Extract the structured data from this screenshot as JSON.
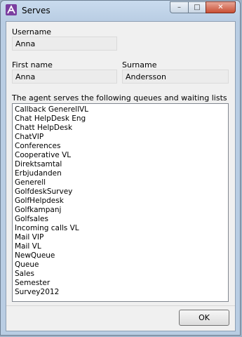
{
  "window": {
    "title": "Serves",
    "icon": "app-logo-icon",
    "controls": {
      "minimize": "minimize-icon",
      "maximize": "maximize-icon",
      "close": "close-icon"
    }
  },
  "form": {
    "username_label": "Username",
    "username_value": "Anna",
    "firstname_label": "First name",
    "firstname_value": "Anna",
    "surname_label": "Surname",
    "surname_value": "Andersson",
    "list_label": "The agent serves the following queues and waiting lists",
    "queues": [
      "Callback GenerellVL",
      "Chat  HelpDesk Eng",
      "Chatt HelpDesk",
      "ChatVIP",
      "Conferences",
      "Cooperative VL",
      "Direktsamtal",
      "Erbjudanden",
      "Generell",
      "GolfdeskSurvey",
      "GolfHelpdesk",
      "Golfkampanj",
      "Golfsales",
      "Incoming calls VL",
      "Mail VIP",
      "Mail VL",
      "NewQueue",
      "Queue",
      "Sales",
      "Semester",
      "Survey2012"
    ]
  },
  "buttons": {
    "ok": "OK"
  },
  "colors": {
    "accent": "#7b3fa0",
    "close": "#c94f34"
  }
}
